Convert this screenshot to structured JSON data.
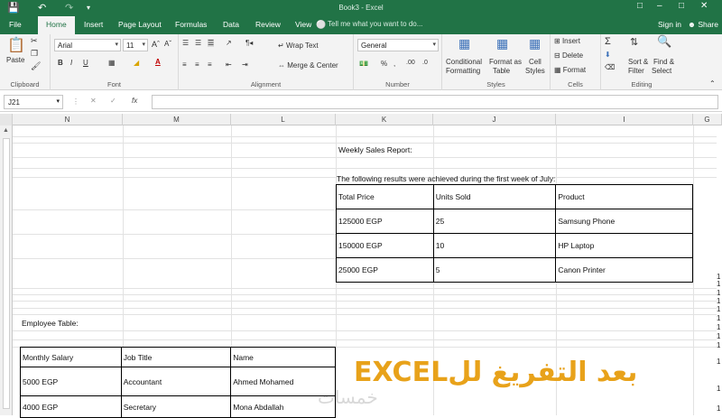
{
  "window": {
    "title": "Book3 - Excel",
    "signin": "Sign in",
    "share": "Share",
    "tell_me": "Tell me what you want to do..."
  },
  "tabs": [
    "File",
    "Home",
    "Insert",
    "Page Layout",
    "Formulas",
    "Data",
    "Review",
    "View"
  ],
  "ribbon": {
    "clipboard": {
      "label": "Clipboard",
      "paste": "Paste"
    },
    "font": {
      "label": "Font",
      "name": "Arial",
      "size": "11"
    },
    "alignment": {
      "label": "Alignment",
      "wrap": "Wrap Text",
      "merge": "Merge & Center"
    },
    "number": {
      "label": "Number",
      "format": "General"
    },
    "styles": {
      "label": "Styles",
      "conditional": "Conditional",
      "conditional2": "Formatting",
      "format_as": "Format as",
      "format_as2": "Table",
      "cell": "Cell",
      "cell2": "Styles"
    },
    "cells": {
      "label": "Cells",
      "insert": "Insert",
      "delete": "Delete",
      "format": "Format"
    },
    "editing": {
      "label": "Editing",
      "sort": "Sort &",
      "sort2": "Filter",
      "find": "Find &",
      "find2": "Select"
    }
  },
  "formula_bar": {
    "name_box": "J21",
    "fx": "fx",
    "value": ""
  },
  "columns": [
    "N",
    "M",
    "L",
    "K",
    "J",
    "I",
    "G"
  ],
  "sheet": {
    "report_title": "Weekly Sales Report:",
    "report_intro": "The following results were achieved during the first week of July:",
    "sales_table": {
      "headers": [
        "Total Price",
        "Units Sold",
        "Product"
      ],
      "rows": [
        [
          "125000 EGP",
          "25",
          "Samsung Phone"
        ],
        [
          "150000 EGP",
          "10",
          "HP Laptop"
        ],
        [
          "25000 EGP",
          "5",
          "Canon Printer"
        ]
      ]
    },
    "employee_title": "Employee Table:",
    "employee_table": {
      "headers": [
        "Monthly Salary",
        "Job Title",
        "Name"
      ],
      "rows": [
        [
          "5000 EGP",
          "Accountant",
          "Ahmed Mohamed"
        ],
        [
          "4000 EGP",
          "Secretary",
          "Mona Abdallah"
        ]
      ]
    },
    "row_numbers": [
      "1",
      "1",
      "1",
      "1",
      "1",
      "1",
      "1",
      "1",
      "1",
      "1",
      "1",
      "1"
    ]
  },
  "overlay": {
    "banner": "بعد التفريغ للEXCEL",
    "watermark": "خمسات"
  }
}
